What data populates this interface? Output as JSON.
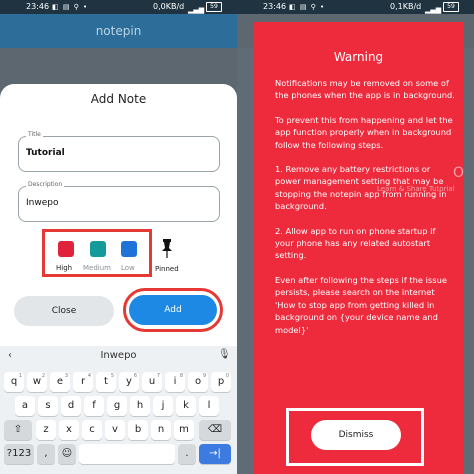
{
  "left": {
    "status": {
      "time": "23:46",
      "net": "0,0KB/d",
      "battery": "59",
      "icons": "◧ ▤ ⚲ •"
    },
    "appbar": {
      "title": "notepin"
    },
    "dialog": {
      "title": "Add Note",
      "title_field": {
        "label": "Title",
        "value": "Tutorial"
      },
      "description_field": {
        "label": "Description",
        "value": "Inwepo"
      },
      "priorities": [
        {
          "label": "High",
          "color": "#e0233b"
        },
        {
          "label": "Medium",
          "color": "#159a9c"
        },
        {
          "label": "Low",
          "color": "#1f72d8"
        }
      ],
      "pinned_label": "Pinned",
      "close_label": "Close",
      "add_label": "Add"
    },
    "keyboard": {
      "suggestion": "Inwepo",
      "row1": [
        "q",
        "w",
        "e",
        "r",
        "t",
        "y",
        "u",
        "i",
        "o",
        "p"
      ],
      "row1_digits": [
        "1",
        "2",
        "3",
        "4",
        "5",
        "6",
        "7",
        "8",
        "9",
        "0"
      ],
      "row2": [
        "a",
        "s",
        "d",
        "f",
        "g",
        "h",
        "j",
        "k",
        "l"
      ],
      "row3": [
        "z",
        "x",
        "c",
        "v",
        "b",
        "n",
        "m"
      ],
      "chev": "‹",
      "mic": "🎙",
      "shift": "⇧",
      "backspace": "⌫",
      "numbers": "?123",
      "comma": ",",
      "emoji": "☺",
      "space": "",
      "period": ".",
      "enter": "→|"
    }
  },
  "right": {
    "status": {
      "time": "23:46",
      "net": "0,1KB/d",
      "battery": "59",
      "icons": "◧ ▤ ⚲ •"
    },
    "dialog": {
      "title": "Warning",
      "paragraphs": [
        "Notifications may be removed on some of the phones when the app is in background.",
        "To prevent this from happening and let the app function properly when in background follow the following steps.",
        "1. Remove any battery restrictions or power management setting that may be stopping the notepin app from running in background.",
        "2. Allow app to run on phone startup if your phone has any related autostart setting.",
        "Even after following the steps if the issue persists, please search on the internet 'How to stop app from getting killed in background on {your device name and model}'"
      ],
      "dismiss_label": "Dismiss"
    },
    "watermark": "Learn & Share Tutorial",
    "watermark_mark": "O"
  },
  "colors": {
    "accent": "#1e88e5",
    "warning": "#ee2b3d",
    "highlight": "#e53935",
    "appbar": "#2c6d99"
  }
}
